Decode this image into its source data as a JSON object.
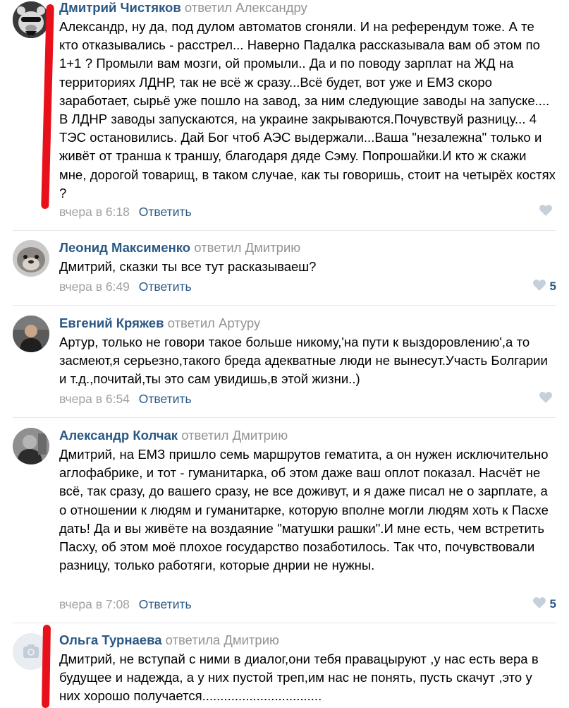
{
  "comments": [
    {
      "author": "Дмитрий Чистяков",
      "reply_to": "ответил Александру",
      "text": "Александр, ну да, под дулом автоматов сгоняли. И на референдум тоже. А те кто отказывались - расстрел... Наверно Падалка рассказывала вам об этом по 1+1 ? Промыли вам мозги, ой промыли.. Да и по поводу зарплат на ЖД на территориях ЛДНР, так не всё ж сразу...Всё будет, вот уже и ЕМЗ скоро заработает, сырьё уже пошло на завод, за ним следующие заводы на запуске.... В ЛДНР заводы запускаются, на украине закрываются.Почувствуй разницу... 4 ТЭС остановились. Дай Бог чтоб АЭС выдержали...Ваша \"незалежна\" только и живёт от транша к траншу, благодаря дяде Сэму. Попрошайки.И кто ж скажи мне, дорогой товарищ, в таком случае, как ты говоришь, стоит на четырёх костях ?",
      "time": "вчера в 6:18",
      "reply_label": "Ответить",
      "likes": ""
    },
    {
      "author": "Леонид Максименко",
      "reply_to": "ответил Дмитрию",
      "text": "Дмитрий, сказки ты все тут расказываеш?",
      "time": "вчера в 6:49",
      "reply_label": "Ответить",
      "likes": "5"
    },
    {
      "author": "Евгений Кряжев",
      "reply_to": "ответил Артуру",
      "text": "Артур, только не говори такое больше никому,'на пути к выздоровлению',а то засмеют,я серьезно,такого бреда адекватные люди не вынесут.Участь Болгарии и т.д.,почитай,ты это сам увидишь,в этой жизни..)",
      "time": "вчера в 6:54",
      "reply_label": "Ответить",
      "likes": ""
    },
    {
      "author": "Александр Колчак",
      "reply_to": "ответил Дмитрию",
      "text": "Дмитрий, на ЕМЗ пришло семь маршрутов гематита, а он нужен исключительно аглофабрике, и тот - гуманитарка, об этом даже ваш оплот показал. Насчёт не всё, так сразу, до вашего сразу, не все доживут, и я даже писал не о зарплате, а о отношении к людям и гуманитарке, которую вполне могли людям хоть к Пасхе дать! Да и вы живёте на воздаяние \"матушки рашки\".И мне есть, чем встретить Пасху, об этом моё плохое государство позаботилось. Так что, почувствовали разницу, только работяги, которые днрии не нужны.",
      "time": "вчера в 7:08",
      "reply_label": "Ответить",
      "likes": "5"
    },
    {
      "author": "Ольга Турнаева",
      "reply_to": "ответила Дмитрию",
      "text": "Дмитрий, не вступай с ними в диалог,они тебя правацыруют ,у нас есть вера в будущее и надежда, а у них пустой треп,им нас не понять, пусть скачут ,это у них хорошо получается.................................",
      "time": "",
      "reply_label": "",
      "likes": ""
    }
  ],
  "colors": {
    "author": "#2a5885",
    "meta": "#a1a1a1",
    "text": "#000000",
    "divider": "#e7e8ec",
    "like_icon": "#c5d0db",
    "highlight_mark": "#e8101a"
  },
  "icons": {
    "like": "heart-icon",
    "camera": "camera-icon"
  }
}
